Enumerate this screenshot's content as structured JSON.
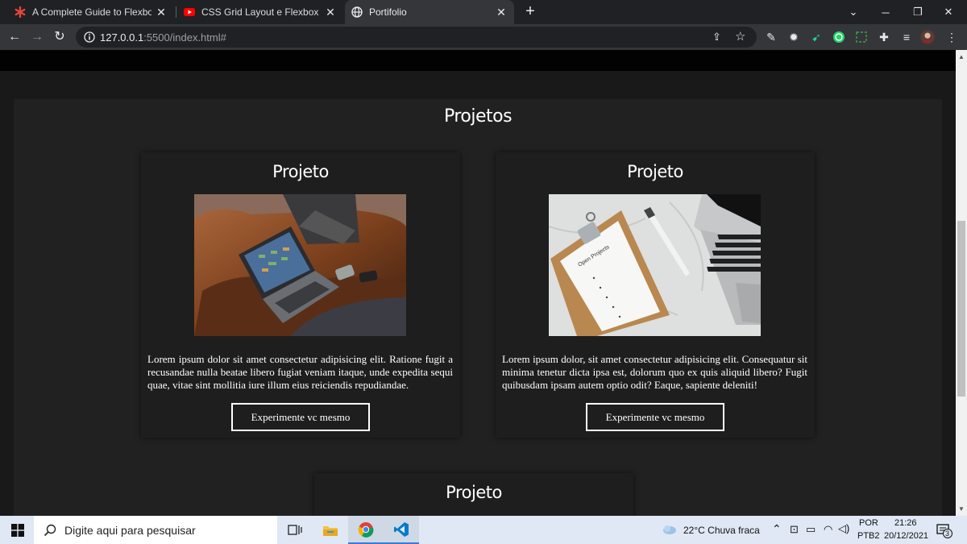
{
  "browser": {
    "tabs": [
      {
        "title": "A Complete Guide to Flexbox - C",
        "icon": "asterisk-icon"
      },
      {
        "title": "CSS Grid Layout e Flexbox - Qua",
        "icon": "youtube-icon"
      },
      {
        "title": "Portifolio",
        "icon": "globe-icon"
      }
    ],
    "url_host": "127.0.0.1",
    "url_path": ":5500/index.html#"
  },
  "page": {
    "section_title": "Projetos",
    "cards": [
      {
        "title": "Projeto",
        "image": "laptop-on-leather-sofa",
        "text": "Lorem ipsum dolor sit amet consectetur adipisicing elit. Ratione fugit a recusandae nulla beatae libero fugiat veniam itaque, unde expedita sequi quae, vitae sint mollitia iure illum eius reiciendis repudiandae.",
        "button": "Experimente vc mesmo"
      },
      {
        "title": "Projeto",
        "image": "clipboard-open-projects",
        "text": "Lorem ipsum dolor, sit amet consectetur adipisicing elit. Consequatur sit minima tenetur dicta ipsa est, dolorum quo ex quis aliquid libero? Fugit quibusdam ipsam autem optio odit? Eaque, sapiente deleniti!",
        "button": "Experimente vc mesmo"
      },
      {
        "title": "Projeto"
      }
    ],
    "clipboard_label": "Open Projects"
  },
  "taskbar": {
    "search_placeholder": "Digite aqui para pesquisar",
    "weather": "22°C  Chuva fraca",
    "lang": "POR",
    "layout": "PTB2",
    "time": "21:26",
    "date": "20/12/2021",
    "notifications": "3"
  },
  "colors": {
    "accent_brave": "#dd2c00",
    "youtube": "#ff0000",
    "vscode": "#007acc"
  }
}
